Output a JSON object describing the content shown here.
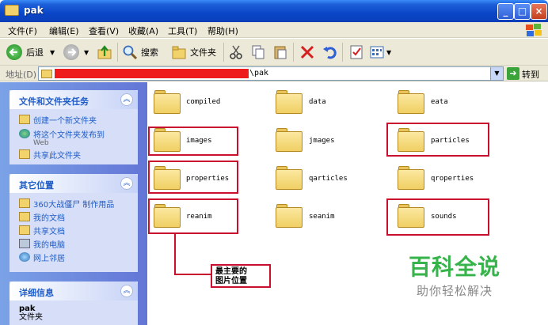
{
  "window": {
    "title": "pak"
  },
  "menu": [
    "文件(F)",
    "编辑(E)",
    "查看(V)",
    "收藏(A)",
    "工具(T)",
    "帮助(H)"
  ],
  "toolbar": {
    "back": "后退",
    "search": "搜索",
    "folders": "文件夹"
  },
  "address": {
    "label": "地址(D)",
    "path_suffix": "\\pak",
    "go": "转到"
  },
  "sidebar": {
    "tasks": {
      "title": "文件和文件夹任务",
      "items": [
        {
          "label": "创建一个新文件夹"
        },
        {
          "label": "将这个文件夹发布到",
          "sub": "Web"
        },
        {
          "label": "共享此文件夹"
        }
      ]
    },
    "places": {
      "title": "其它位置",
      "items": [
        {
          "label": "360大战僵尸 制作用品"
        },
        {
          "label": "我的文档"
        },
        {
          "label": "共享文档"
        },
        {
          "label": "我的电脑"
        },
        {
          "label": "网上邻居"
        }
      ]
    },
    "details": {
      "title": "详细信息",
      "name": "pak",
      "type": "文件夹"
    }
  },
  "folders": [
    {
      "name": "compiled",
      "highlighted": false
    },
    {
      "name": "data",
      "highlighted": false
    },
    {
      "name": "eata",
      "highlighted": false
    },
    {
      "name": "images",
      "highlighted": true
    },
    {
      "name": "jmages",
      "highlighted": false
    },
    {
      "name": "particles",
      "highlighted": true
    },
    {
      "name": "properties",
      "highlighted": true
    },
    {
      "name": "qarticles",
      "highlighted": false
    },
    {
      "name": "qroperties",
      "highlighted": false
    },
    {
      "name": "reanim",
      "highlighted": true
    },
    {
      "name": "seanim",
      "highlighted": false
    },
    {
      "name": "sounds",
      "highlighted": true
    }
  ],
  "callout": {
    "line1": "最主要的",
    "line2": "图片位置"
  },
  "watermark": {
    "main": "百科全说",
    "sub": "助你轻松解决"
  }
}
